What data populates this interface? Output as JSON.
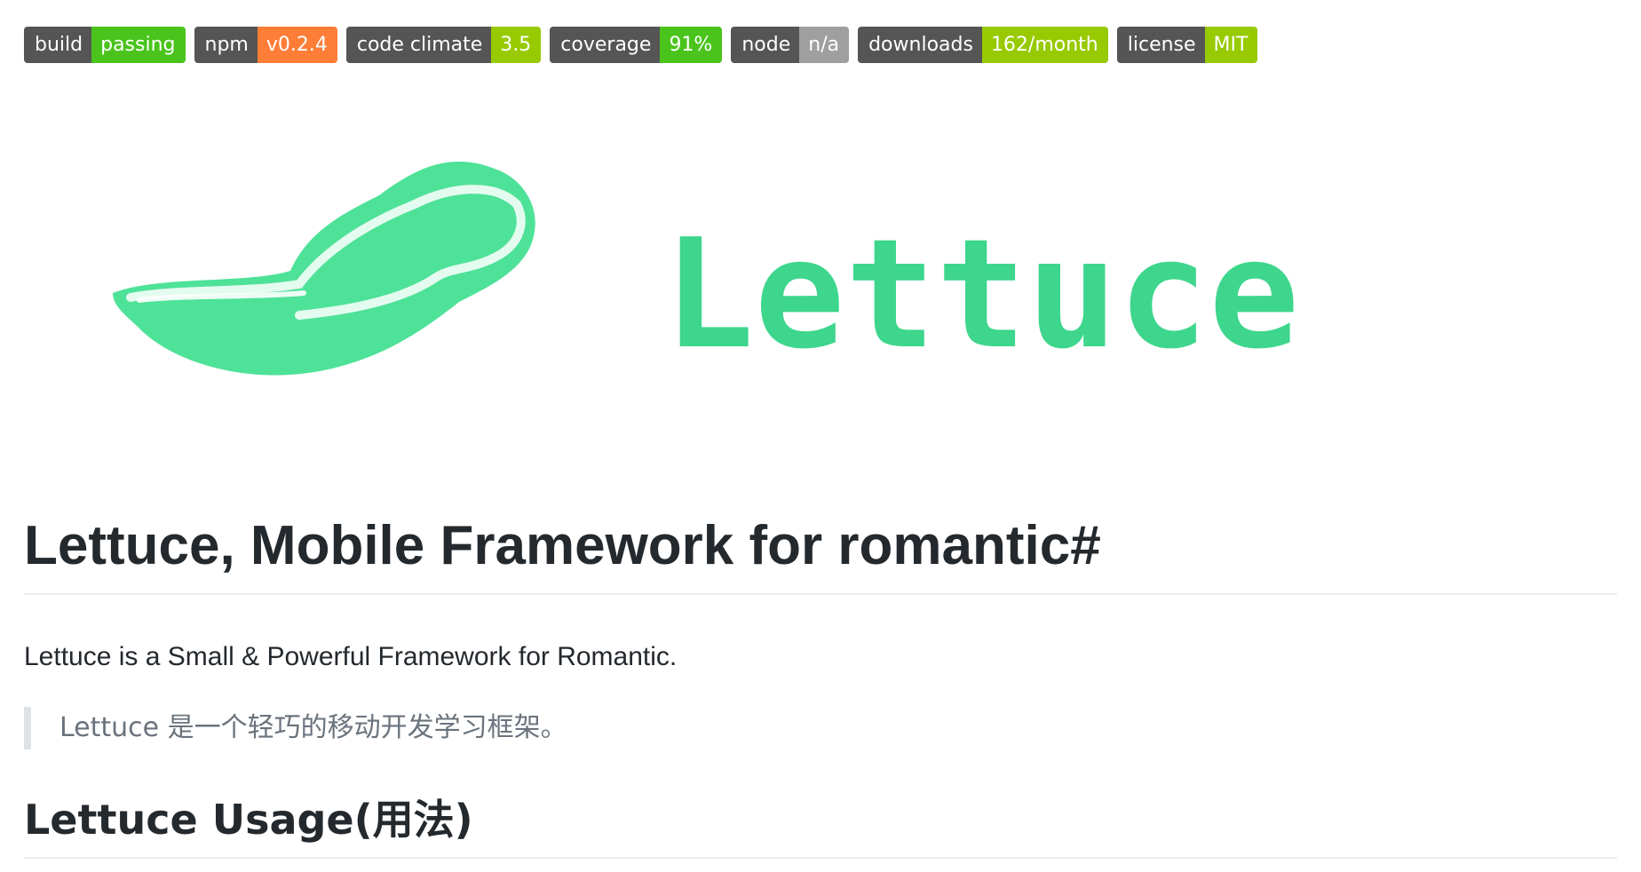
{
  "badges": [
    {
      "label": "build",
      "value": "passing",
      "color": "#4c1"
    },
    {
      "label": "npm",
      "value": "v0.2.4",
      "color": "#fe7d37"
    },
    {
      "label": "code climate",
      "value": "3.5",
      "color": "#a4a61d"
    },
    {
      "label": "coverage",
      "value": "91%",
      "color": "#4c1"
    },
    {
      "label": "node",
      "value": "n/a",
      "color": "#9f9f9f"
    },
    {
      "label": "downloads",
      "value": "162/month",
      "color": "#97ca00"
    },
    {
      "label": "license",
      "value": "MIT",
      "color": "#97ca00"
    }
  ],
  "logo": {
    "text": "Lettuce",
    "color": "#3dd68c"
  },
  "heading": {
    "title": "Lettuce, Mobile Framework for romantic",
    "anchor": "#"
  },
  "intro": "Lettuce is a Small & Powerful Framework for Romantic.",
  "quote": "Lettuce 是一个轻巧的移动开发学习框架。",
  "usage_heading": "Lettuce Usage(用法)"
}
